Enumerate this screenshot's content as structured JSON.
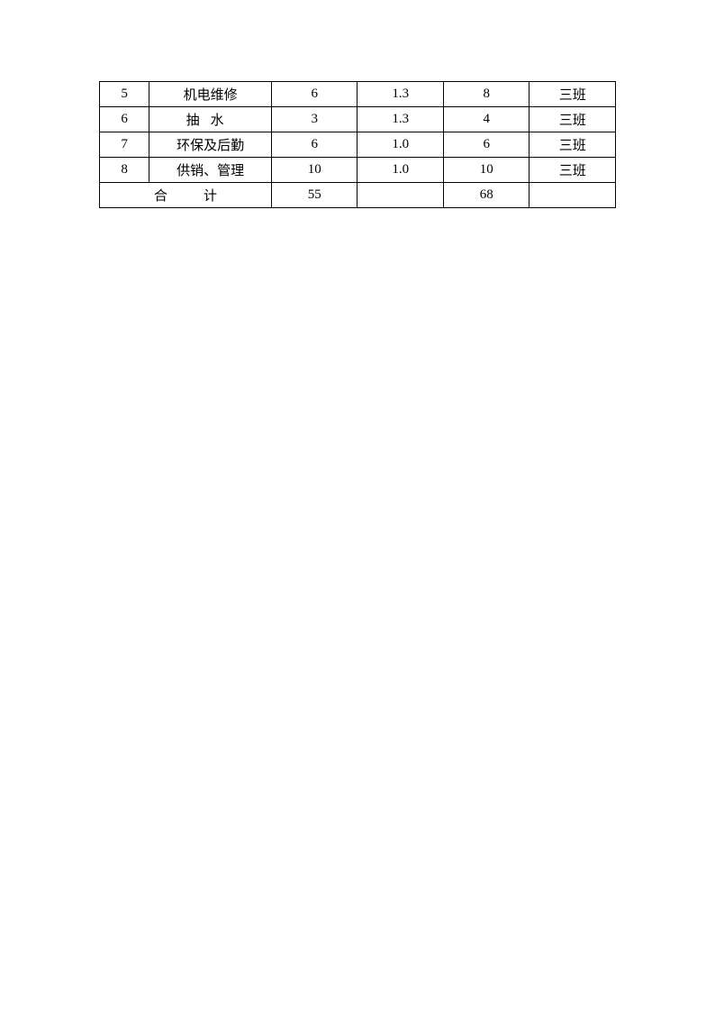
{
  "table": {
    "rows": [
      {
        "num": "5",
        "name": "机电维修",
        "a": "6",
        "b": "1.3",
        "c": "8",
        "d": "三班",
        "spaced": false
      },
      {
        "num": "6",
        "name": "抽水",
        "a": "3",
        "b": "1.3",
        "c": "4",
        "d": "三班",
        "spaced": true
      },
      {
        "num": "7",
        "name": "环保及后勤",
        "a": "6",
        "b": "1.0",
        "c": "6",
        "d": "三班",
        "spaced": false
      },
      {
        "num": "8",
        "name": "供销、管理",
        "a": "10",
        "b": "1.0",
        "c": "10",
        "d": "三班",
        "spaced": false
      }
    ],
    "total": {
      "label": "合计",
      "a": "55",
      "b": "",
      "c": "68",
      "d": ""
    }
  }
}
